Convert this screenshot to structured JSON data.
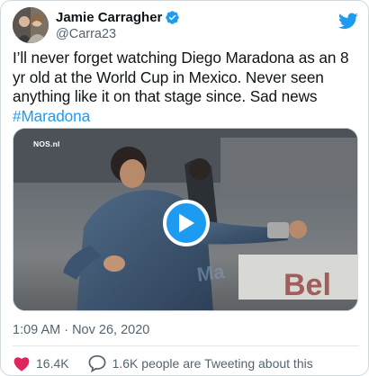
{
  "tweet": {
    "author": {
      "display_name": "Jamie Carragher",
      "handle": "@Carra23",
      "verified": true
    },
    "text_main": "I’ll never forget watching Diego Maradona as an 8 yr old at the World Cup in Mexico. Never seen anything like it on that stage since. Sad news ",
    "hashtag": "#Maradona",
    "media": {
      "type": "video",
      "watermark": "NOS.nl"
    },
    "timestamp": "1:09 AM · Nov 26, 2020",
    "actions": {
      "like_count": "16.4K",
      "people_tweeting": "1.6K people are Tweeting about this"
    }
  },
  "colors": {
    "accent": "#1d9bf0",
    "like_red": "#e0245e",
    "secondary_text": "#536471"
  },
  "icons": {
    "platform": "twitter-bird-icon",
    "verified": "verified-badge-icon",
    "play": "play-icon",
    "like": "heart-icon",
    "comments": "speech-bubble-icon"
  }
}
